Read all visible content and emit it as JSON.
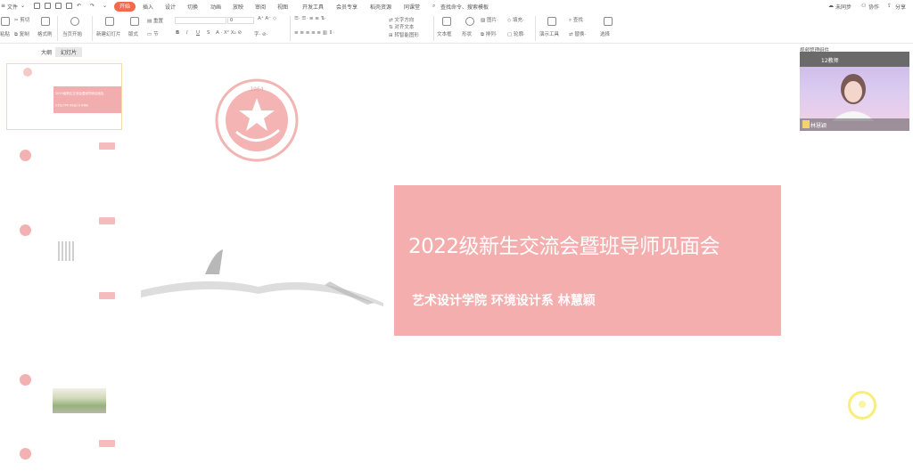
{
  "topbar": {
    "file_menu": "文件",
    "tabs": [
      "开始",
      "插入",
      "设计",
      "切换",
      "动画",
      "放映",
      "审阅",
      "视图",
      "开发工具",
      "会员专享",
      "稻壳资源",
      "同课堂"
    ],
    "search_placeholder": "查找命令、搜索模板",
    "sync": "未同步",
    "collab": "协作",
    "share": "分享"
  },
  "ribbon": {
    "paste": "粘贴",
    "cut": "剪切",
    "copy": "复制",
    "format_painter": "格式刷",
    "play_from_current": "当页开始",
    "new_slide": "新建幻灯片",
    "layout": "版式",
    "section": "节",
    "reset": "重置",
    "font_size": "0",
    "text_direction": "文字方向",
    "align_text": "对齐文本",
    "convert_smartart": "转智能图形",
    "textbox": "文本框",
    "shape": "形状",
    "picture": "图片",
    "fill": "填充",
    "arrange": "排列",
    "outline": "轮廓",
    "presentation_tools": "演示工具",
    "find": "查找",
    "replace": "替换",
    "select": "选择"
  },
  "left_pane": {
    "tabs": [
      "大纲",
      "幻灯片"
    ],
    "thumb1_title": "2022级新生交流会暨班导师见面会",
    "thumb1_sub": "艺术设计学院 环境设计系 林慧颖"
  },
  "slide": {
    "title": "2022级新生交流会暨班导师见面会",
    "subtitle": "艺术设计学院  环境设计系   林慧颖",
    "logo_text": "1964",
    "colors": {
      "accent": "#f4aeae",
      "brand": "#f26a4b"
    }
  },
  "right_panel": {
    "header": "视频管理组件",
    "participant_top": "12教师",
    "participant": "林慧颖"
  }
}
